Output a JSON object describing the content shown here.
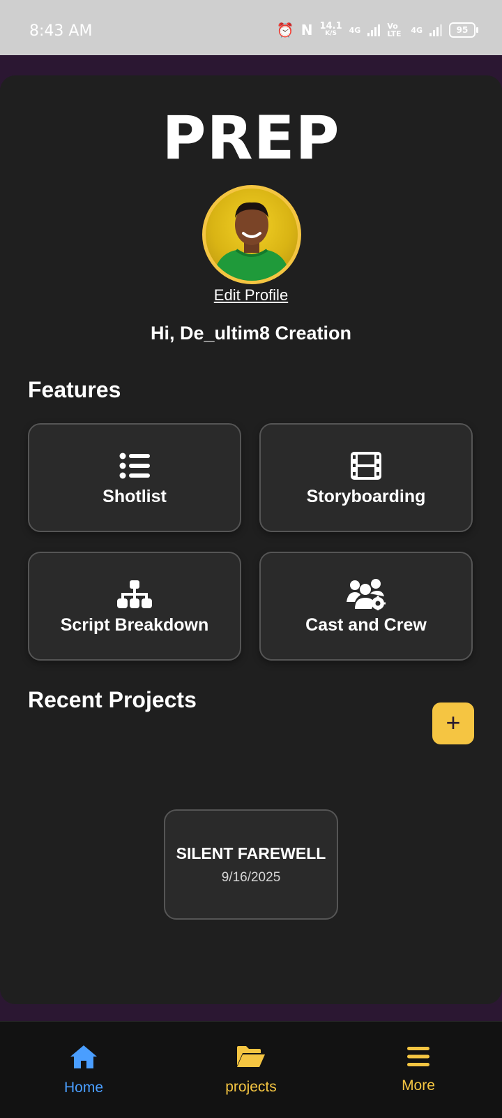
{
  "status_bar": {
    "time": "8:43 AM",
    "net_speed": "14.1",
    "net_speed_unit": "K/S",
    "network_1": "4G",
    "volte": "Vo LTE",
    "network_2": "4G",
    "battery": "95"
  },
  "app": {
    "title": "PREP",
    "edit_profile": "Edit Profile",
    "greeting": "Hi, De_ultim8 Creation"
  },
  "features": {
    "title": "Features",
    "items": [
      {
        "label": "Shotlist",
        "icon": "list-icon"
      },
      {
        "label": "Storyboarding",
        "icon": "film-icon"
      },
      {
        "label": "Script Breakdown",
        "icon": "sitemap-icon"
      },
      {
        "label": "Cast and Crew",
        "icon": "users-gear-icon"
      }
    ]
  },
  "recent_projects": {
    "title": "Recent Projects",
    "add_label": "+",
    "items": [
      {
        "name": "SILENT FAREWELL",
        "date": "9/16/2025"
      }
    ]
  },
  "nav": {
    "items": [
      {
        "label": "Home",
        "icon": "home-icon",
        "color": "#4a9eff",
        "active": true
      },
      {
        "label": "projects",
        "icon": "folder-open-icon",
        "color": "#f4c542",
        "active": false
      },
      {
        "label": "More",
        "icon": "menu-icon",
        "color": "#f4c542",
        "active": false
      }
    ]
  },
  "colors": {
    "accent": "#f5c542",
    "active_nav": "#4a9eff",
    "card_bg": "#2a2a2a",
    "page_bg": "#1f1f1f",
    "frame_bg": "#2b1732"
  }
}
